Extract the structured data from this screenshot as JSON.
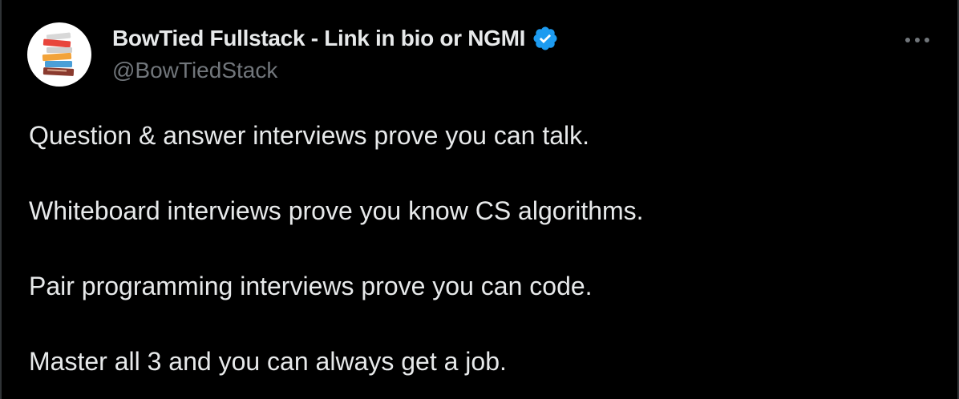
{
  "author": {
    "display_name": "BowTied Fullstack - Link in bio or NGMI",
    "handle": "@BowTiedStack",
    "verified": true,
    "avatar_icon": "stacked-books-icon"
  },
  "more_menu": {
    "icon": "more-horizontal-icon"
  },
  "tweet": {
    "paragraphs": [
      "Question & answer interviews prove you can talk.",
      "Whiteboard interviews prove you know CS algorithms.",
      "Pair programming interviews prove you can code.",
      "Master all 3 and you can always get a job."
    ]
  },
  "colors": {
    "background": "#000000",
    "text_primary": "#e7e9ea",
    "text_secondary": "#71767b",
    "verified_badge": "#1d9bf0"
  }
}
